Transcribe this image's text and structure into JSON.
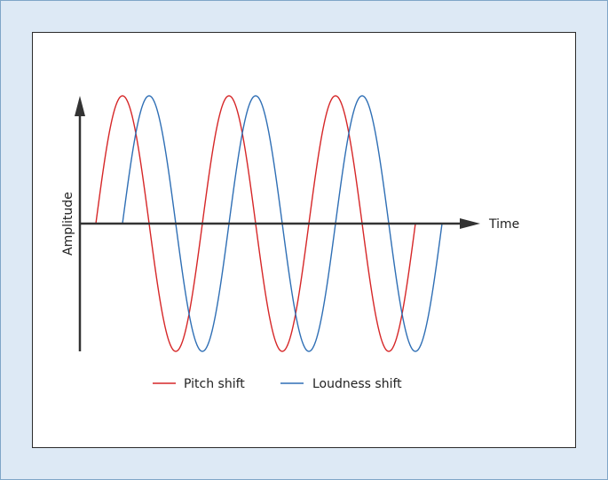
{
  "diagram": {
    "x_axis_label": "Time",
    "y_axis_label": "Amplitude",
    "colors": {
      "background": "#dde9f5",
      "panel": "#ffffff",
      "axis": "#333333",
      "pitch": "#d62728",
      "loudness": "#2f6fb5"
    },
    "series": [
      {
        "name": "Pitch shift",
        "color": "#d62728",
        "cycles": 3,
        "phase_shift": 0
      },
      {
        "name": "Loudness shift",
        "color": "#2f6fb5",
        "cycles": 3,
        "phase_shift": 0.25
      }
    ]
  },
  "legend": {
    "pitch_label": "Pitch shift",
    "loudness_label": "Loudness shift"
  }
}
